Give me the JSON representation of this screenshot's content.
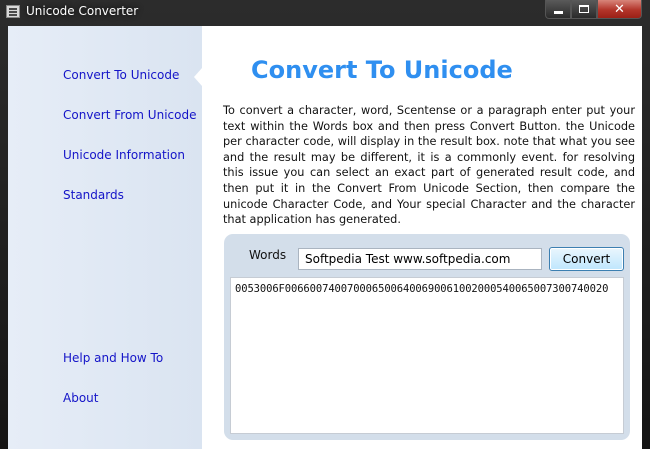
{
  "window": {
    "title": "Unicode Converter",
    "controls": {
      "minimize": "minimize",
      "maximize": "maximize",
      "close": "✕"
    }
  },
  "sidebar": {
    "items": [
      {
        "label": "Convert To Unicode",
        "selected": true
      },
      {
        "label": "Convert From Unicode"
      },
      {
        "label": "Unicode Information"
      },
      {
        "label": "Standards"
      },
      {
        "label": "Help and How To"
      },
      {
        "label": "About"
      }
    ]
  },
  "main": {
    "heading": "Convert To Unicode",
    "description": "To convert a character, word, Scentense or a paragraph enter put your text within the Words box and then press Convert Button. the Unicode per character code, will display in the result box. note that what you see and the result may be different, it is a commonly event. for resolving this issue you can select an exact part of generated result code, and then put it in the Convert From Unicode Section, then compare the unicode Character Code, and Your special Character and the character that application has generated.",
    "words_label": "Words",
    "words_value": "Softpedia Test www.softpedia.com",
    "convert_label": "Convert",
    "result": "0053006F0066007400700065006400690061002000540065007300740020"
  },
  "colors": {
    "heading": "#2f8ff0",
    "nav_link": "#1414c8",
    "sidebar_bg": "#e6edf7",
    "panel_bg": "#d3deea",
    "close_button": "#b3352a"
  }
}
